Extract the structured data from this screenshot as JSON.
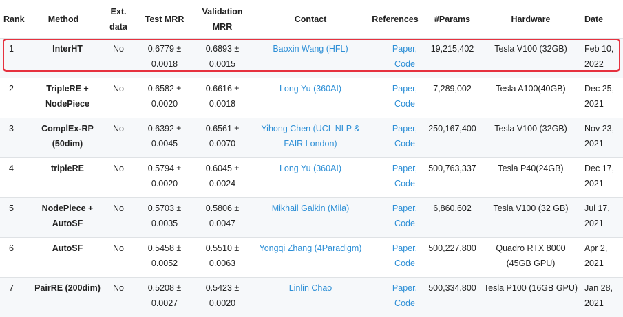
{
  "headers": {
    "rank": [
      "Rank"
    ],
    "method": [
      "Method"
    ],
    "ext": [
      "Ext.",
      "data"
    ],
    "test": [
      "Test MRR"
    ],
    "val": [
      "Validation",
      "MRR"
    ],
    "contact": [
      "Contact"
    ],
    "refs": [
      "References"
    ],
    "params": [
      "#Params"
    ],
    "hardware": [
      "Hardware"
    ],
    "date": [
      "Date"
    ]
  },
  "colors": {
    "link": "#2d8fd6",
    "highlight": "#e6323f",
    "stripe": "#f6f8fa"
  },
  "rows": [
    {
      "rank": "1",
      "method": [
        "InterHT"
      ],
      "ext": "No",
      "test": [
        "0.6779 ±",
        "0.0018"
      ],
      "val": [
        "0.6893 ±",
        "0.0015"
      ],
      "contact": [
        "Baoxin Wang (HFL)"
      ],
      "paper": "Paper,",
      "code": "Code",
      "params": "19,215,402",
      "hardware": [
        "Tesla V100 (32GB)"
      ],
      "date": [
        "Feb 10,",
        "2022"
      ]
    },
    {
      "rank": "2",
      "method": [
        "TripleRE +",
        "NodePiece"
      ],
      "ext": "No",
      "test": [
        "0.6582 ±",
        "0.0020"
      ],
      "val": [
        "0.6616 ±",
        "0.0018"
      ],
      "contact": [
        "Long Yu (360AI)"
      ],
      "paper": "Paper,",
      "code": "Code",
      "params": "7,289,002",
      "hardware": [
        "Tesla A100(40GB)"
      ],
      "date": [
        "Dec 25,",
        "2021"
      ]
    },
    {
      "rank": "3",
      "method": [
        "ComplEx-RP",
        "(50dim)"
      ],
      "ext": "No",
      "test": [
        "0.6392 ±",
        "0.0045"
      ],
      "val": [
        "0.6561 ±",
        "0.0070"
      ],
      "contact": [
        "Yihong Chen (UCL NLP &",
        "FAIR London)"
      ],
      "paper": "Paper,",
      "code": "Code",
      "params": "250,167,400",
      "hardware": [
        "Tesla V100 (32GB)"
      ],
      "date": [
        "Nov 23,",
        "2021"
      ]
    },
    {
      "rank": "4",
      "method": [
        "tripleRE"
      ],
      "ext": "No",
      "test": [
        "0.5794 ±",
        "0.0020"
      ],
      "val": [
        "0.6045 ±",
        "0.0024"
      ],
      "contact": [
        "Long Yu (360AI)"
      ],
      "paper": "Paper,",
      "code": "Code",
      "params": "500,763,337",
      "hardware": [
        "Tesla P40(24GB)"
      ],
      "date": [
        "Dec 17,",
        "2021"
      ]
    },
    {
      "rank": "5",
      "method": [
        "NodePiece +",
        "AutoSF"
      ],
      "ext": "No",
      "test": [
        "0.5703 ±",
        "0.0035"
      ],
      "val": [
        "0.5806 ±",
        "0.0047"
      ],
      "contact": [
        "Mikhail Galkin (Mila)"
      ],
      "paper": "Paper,",
      "code": "Code",
      "params": "6,860,602",
      "hardware": [
        "Tesla V100 (32 GB)"
      ],
      "date": [
        "Jul 17,",
        "2021"
      ]
    },
    {
      "rank": "6",
      "method": [
        "AutoSF"
      ],
      "ext": "No",
      "test": [
        "0.5458 ±",
        "0.0052"
      ],
      "val": [
        "0.5510 ±",
        "0.0063"
      ],
      "contact": [
        "Yongqi Zhang (4Paradigm)"
      ],
      "paper": "Paper,",
      "code": "Code",
      "params": "500,227,800",
      "hardware": [
        "Quadro RTX 8000",
        "(45GB GPU)"
      ],
      "date": [
        "Apr 2,",
        "2021"
      ]
    },
    {
      "rank": "7",
      "method": [
        "PairRE (200dim)"
      ],
      "ext": "No",
      "test": [
        "0.5208 ±",
        "0.0027"
      ],
      "val": [
        "0.5423 ±",
        "0.0020"
      ],
      "contact": [
        "Linlin Chao"
      ],
      "paper": "Paper,",
      "code": "Code",
      "params": "500,334,800",
      "hardware": [
        "Tesla P100 (16GB GPU)"
      ],
      "date": [
        "Jan 28,",
        "2021"
      ]
    }
  ]
}
